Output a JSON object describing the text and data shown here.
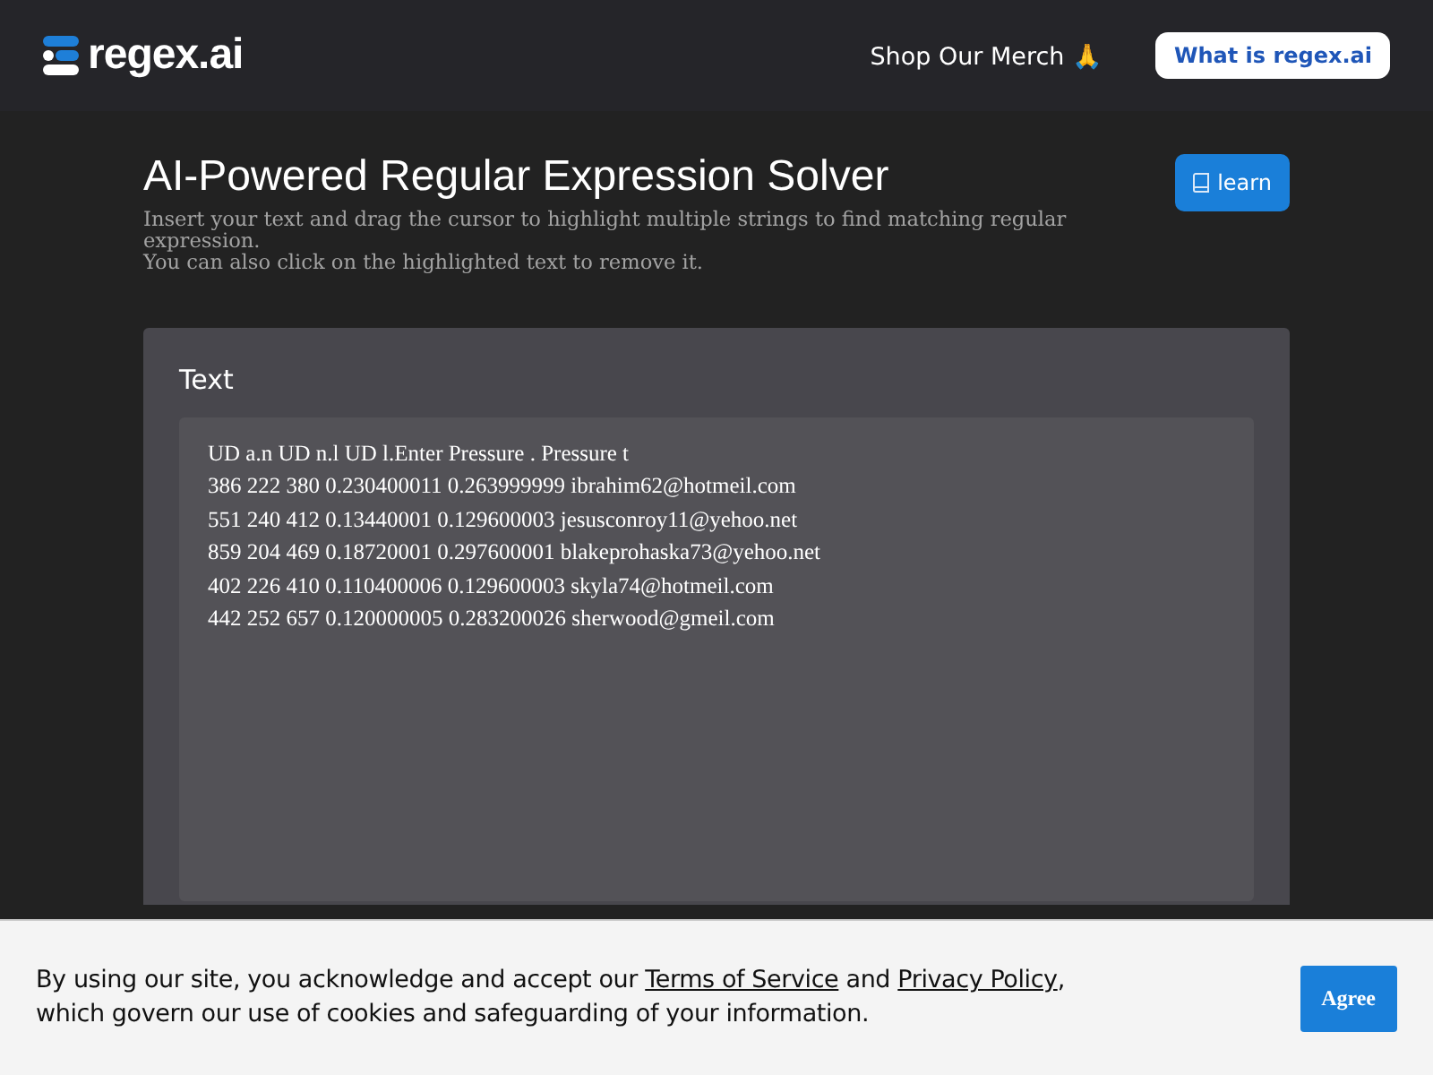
{
  "header": {
    "logo": "regex.ai",
    "merch_link": "Shop Our Merch 🙏",
    "about_button": "What is regex.ai"
  },
  "intro": {
    "title": "AI-Powered Regular Expression Solver",
    "description_lines": [
      "Insert your text and drag the cursor to highlight multiple strings to find matching regular expression.",
      "You can also click on the highlighted text to remove it."
    ],
    "learn_button": "learn"
  },
  "text_panel": {
    "label": "Text",
    "lines": [
      "UD a.n UD n.l UD l.Enter Pressure . Pressure t",
      "386 222 380 0.230400011 0.263999999 ibrahim62@hotmeil.com",
      "551 240 412 0.13440001 0.129600003 jesusconroy11@yehoo.net",
      "859 204 469 0.18720001 0.297600001 blakeprohaska73@yehoo.net",
      "402 226 410 0.110400006 0.129600003 skyla74@hotmeil.com",
      "442 252 657 0.120000005 0.283200026 sherwood@gmeil.com"
    ]
  },
  "cookie_banner": {
    "text_before": "By using our site, you acknowledge and accept our ",
    "terms_link": "Terms of Service",
    "text_middle": " and ",
    "privacy_link": "Privacy Policy",
    "text_after": ",\nwhich govern our use of cookies and safeguarding of your information.",
    "agree_button": "Agree"
  }
}
